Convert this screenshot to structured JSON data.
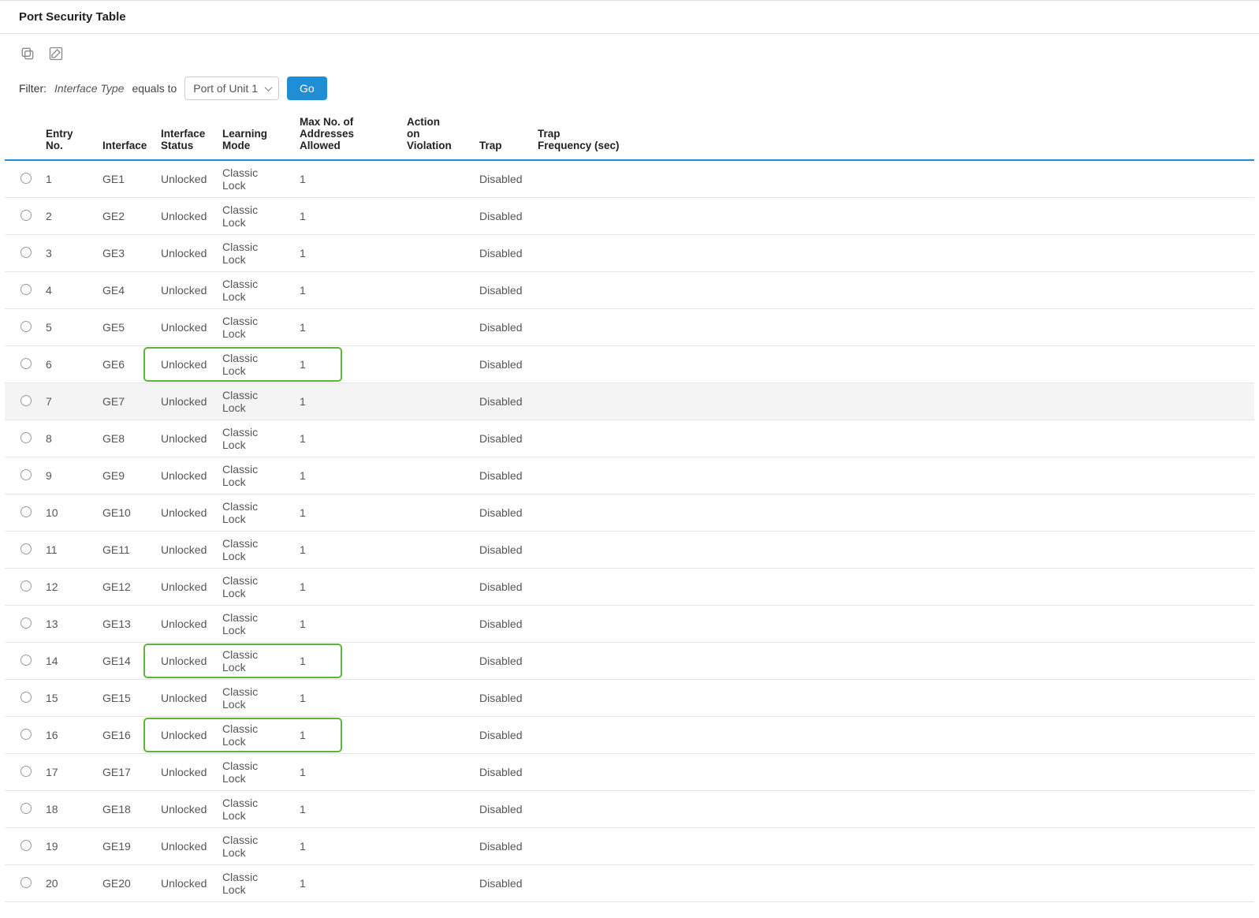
{
  "title": "Port Security Table",
  "filter": {
    "label": "Filter:",
    "field_label": "Interface Type",
    "equals": "equals to",
    "select_value": "Port of Unit 1",
    "go_label": "Go"
  },
  "columns": {
    "radio": "",
    "entry": "Entry No.",
    "interface": "Interface",
    "status": "Interface\nStatus",
    "mode": "Learning\nMode",
    "max": "Max No. of\nAddresses Allowed",
    "action": "Action\non Violation",
    "trap": "Trap",
    "freq": "Trap\nFrequency (sec)"
  },
  "rows": [
    {
      "n": "1",
      "if": "GE1",
      "st": "Unlocked",
      "mode": "Classic Lock",
      "max": "1",
      "act": "",
      "trap": "Disabled",
      "freq": "",
      "hl": false,
      "hover": false
    },
    {
      "n": "2",
      "if": "GE2",
      "st": "Unlocked",
      "mode": "Classic Lock",
      "max": "1",
      "act": "",
      "trap": "Disabled",
      "freq": "",
      "hl": false,
      "hover": false
    },
    {
      "n": "3",
      "if": "GE3",
      "st": "Unlocked",
      "mode": "Classic Lock",
      "max": "1",
      "act": "",
      "trap": "Disabled",
      "freq": "",
      "hl": false,
      "hover": false
    },
    {
      "n": "4",
      "if": "GE4",
      "st": "Unlocked",
      "mode": "Classic Lock",
      "max": "1",
      "act": "",
      "trap": "Disabled",
      "freq": "",
      "hl": false,
      "hover": false
    },
    {
      "n": "5",
      "if": "GE5",
      "st": "Unlocked",
      "mode": "Classic Lock",
      "max": "1",
      "act": "",
      "trap": "Disabled",
      "freq": "",
      "hl": false,
      "hover": false
    },
    {
      "n": "6",
      "if": "GE6",
      "st": "Unlocked",
      "mode": "Classic Lock",
      "max": "1",
      "act": "",
      "trap": "Disabled",
      "freq": "",
      "hl": true,
      "hover": false
    },
    {
      "n": "7",
      "if": "GE7",
      "st": "Unlocked",
      "mode": "Classic Lock",
      "max": "1",
      "act": "",
      "trap": "Disabled",
      "freq": "",
      "hl": false,
      "hover": true
    },
    {
      "n": "8",
      "if": "GE8",
      "st": "Unlocked",
      "mode": "Classic Lock",
      "max": "1",
      "act": "",
      "trap": "Disabled",
      "freq": "",
      "hl": false,
      "hover": false
    },
    {
      "n": "9",
      "if": "GE9",
      "st": "Unlocked",
      "mode": "Classic Lock",
      "max": "1",
      "act": "",
      "trap": "Disabled",
      "freq": "",
      "hl": false,
      "hover": false
    },
    {
      "n": "10",
      "if": "GE10",
      "st": "Unlocked",
      "mode": "Classic Lock",
      "max": "1",
      "act": "",
      "trap": "Disabled",
      "freq": "",
      "hl": false,
      "hover": false
    },
    {
      "n": "11",
      "if": "GE11",
      "st": "Unlocked",
      "mode": "Classic Lock",
      "max": "1",
      "act": "",
      "trap": "Disabled",
      "freq": "",
      "hl": false,
      "hover": false
    },
    {
      "n": "12",
      "if": "GE12",
      "st": "Unlocked",
      "mode": "Classic Lock",
      "max": "1",
      "act": "",
      "trap": "Disabled",
      "freq": "",
      "hl": false,
      "hover": false
    },
    {
      "n": "13",
      "if": "GE13",
      "st": "Unlocked",
      "mode": "Classic Lock",
      "max": "1",
      "act": "",
      "trap": "Disabled",
      "freq": "",
      "hl": false,
      "hover": false
    },
    {
      "n": "14",
      "if": "GE14",
      "st": "Unlocked",
      "mode": "Classic Lock",
      "max": "1",
      "act": "",
      "trap": "Disabled",
      "freq": "",
      "hl": true,
      "hover": false
    },
    {
      "n": "15",
      "if": "GE15",
      "st": "Unlocked",
      "mode": "Classic Lock",
      "max": "1",
      "act": "",
      "trap": "Disabled",
      "freq": "",
      "hl": false,
      "hover": false
    },
    {
      "n": "16",
      "if": "GE16",
      "st": "Unlocked",
      "mode": "Classic Lock",
      "max": "1",
      "act": "",
      "trap": "Disabled",
      "freq": "",
      "hl": true,
      "hover": false
    },
    {
      "n": "17",
      "if": "GE17",
      "st": "Unlocked",
      "mode": "Classic Lock",
      "max": "1",
      "act": "",
      "trap": "Disabled",
      "freq": "",
      "hl": false,
      "hover": false
    },
    {
      "n": "18",
      "if": "GE18",
      "st": "Unlocked",
      "mode": "Classic Lock",
      "max": "1",
      "act": "",
      "trap": "Disabled",
      "freq": "",
      "hl": false,
      "hover": false
    },
    {
      "n": "19",
      "if": "GE19",
      "st": "Unlocked",
      "mode": "Classic Lock",
      "max": "1",
      "act": "",
      "trap": "Disabled",
      "freq": "",
      "hl": false,
      "hover": false
    },
    {
      "n": "20",
      "if": "GE20",
      "st": "Unlocked",
      "mode": "Classic Lock",
      "max": "1",
      "act": "",
      "trap": "Disabled",
      "freq": "",
      "hl": false,
      "hover": false
    }
  ]
}
